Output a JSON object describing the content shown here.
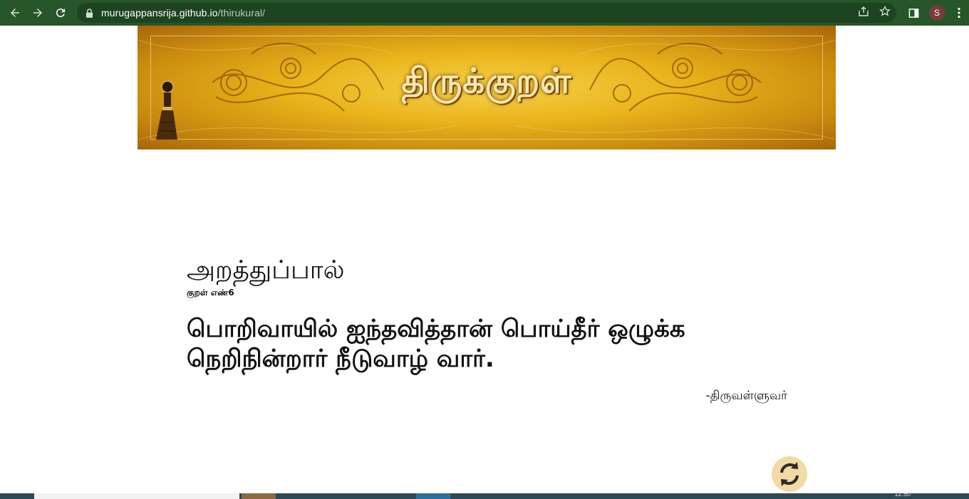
{
  "browser": {
    "url_host": "murugappansrija.github.io",
    "url_path": "/thirukural/",
    "profile_initial": "S"
  },
  "banner": {
    "title": "திருக்குறள்"
  },
  "content": {
    "section_title": "அறத்துப்பால்",
    "kural_number_label": "குறள் எண்6",
    "kural_line_1": "பொறிவாயில் ஐந்தவித்தான் பொய்தீர் ஒழுக்க",
    "kural_line_2": "நெறிநின்றார் நீடுவாழ் வார்.",
    "author": "-திருவள்ளுவர்"
  },
  "taskbar": {
    "clock": "12:50"
  },
  "colors": {
    "chrome_bg": "#26562a",
    "omnibox_bg": "#1d4420",
    "banner_gold": "#e9b31a",
    "refresh_bg": "#f3d9a4"
  }
}
